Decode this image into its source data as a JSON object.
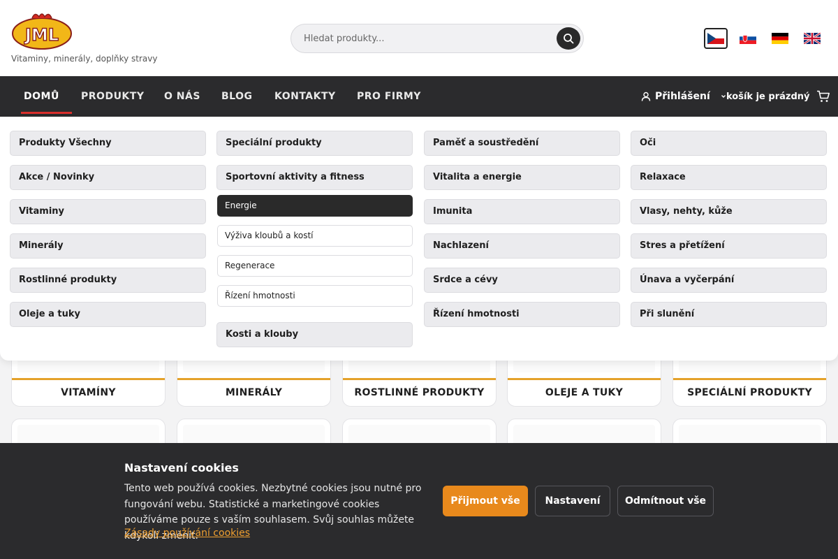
{
  "header": {
    "brand": "JML",
    "tagline": "Vitaminy, minerály, doplňky stravy",
    "search_placeholder": "Hledat produkty...",
    "languages": [
      "CZ",
      "SK",
      "DE",
      "EN"
    ]
  },
  "nav": {
    "items": [
      "DOMŮ",
      "PRODUKTY",
      "O NÁS",
      "BLOG",
      "KONTAKTY",
      "PRO FIRMY"
    ],
    "active": "DOMŮ",
    "login": "Přihlášení",
    "cart": "košík je prázdný"
  },
  "menu": {
    "col1": [
      "Produkty Všechny",
      "Akce / Novinky",
      "Vitaminy",
      "Minerály",
      "Rostlinné produkty",
      "Oleje a tuky"
    ],
    "col2_top": [
      "Speciální produkty",
      "Sportovní aktivity a fitness"
    ],
    "col2_sub": [
      "Energie",
      "Výživa kloubů a kostí",
      "Regenerace",
      "Řízení hmotnosti"
    ],
    "col2_bottom": "Kosti a klouby",
    "col3": [
      "Paměť a soustředění",
      "Vitalita a energie",
      "Imunita",
      "Nachlazení",
      "Srdce a cévy",
      "Řízení hmotnosti"
    ],
    "col4": [
      "Oči",
      "Relaxace",
      "Vlasy, nehty, kůže",
      "Stres a přetížení",
      "Únava a vyčerpání",
      "Při slunění"
    ]
  },
  "categories": [
    "VITAMÍNY",
    "MINERÁLY",
    "ROSTLINNÉ PRODUKTY",
    "OLEJE A TUKY",
    "SPECIÁLNÍ PRODUKTY"
  ],
  "cookies": {
    "title": "Nastavení cookies",
    "text": "Tento web používá cookies. Nezbytné cookies jsou nutné pro fungování webu. Statistické a marketingové cookies používáme pouze s vaším souhlasem. Svůj souhlas můžete kdykoli změnit.",
    "link": "Zásady používání cookies",
    "accept": "Přijmout vše",
    "settings": "Nastavení",
    "reject": "Odmítnout vše"
  },
  "colors": {
    "nav_bg": "#2b2b2d",
    "accent": "#e8891c",
    "active_underline": "#d9302c",
    "card_bar": "#e5a22a"
  }
}
